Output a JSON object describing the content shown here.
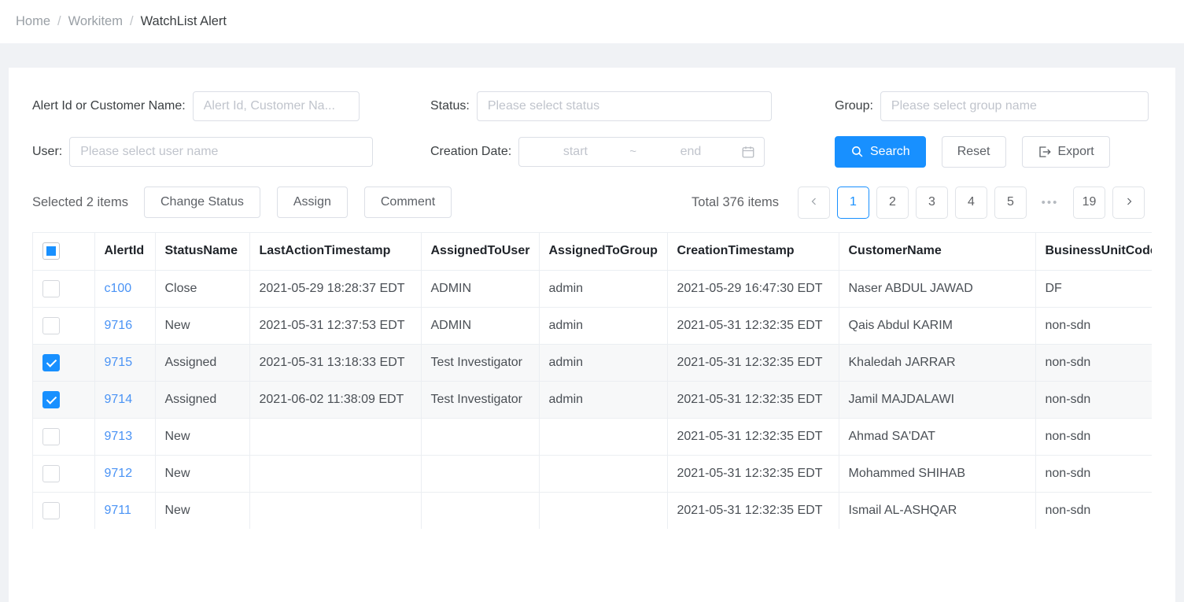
{
  "breadcrumb": {
    "items": [
      {
        "label": "Home",
        "current": false
      },
      {
        "label": "Workitem",
        "current": false
      },
      {
        "label": "WatchList Alert",
        "current": true
      }
    ],
    "separator": "/"
  },
  "filters": {
    "alert_id": {
      "label": "Alert Id or Customer Name:",
      "placeholder": "Alert Id, Customer Na...",
      "value": ""
    },
    "status": {
      "label": "Status:",
      "placeholder": "Please select status",
      "value": ""
    },
    "group": {
      "label": "Group:",
      "placeholder": "Please select group name",
      "value": ""
    },
    "user": {
      "label": "User:",
      "placeholder": "Please select user name",
      "value": ""
    },
    "creation_date": {
      "label": "Creation Date:",
      "start_placeholder": "start",
      "end_placeholder": "end",
      "separator": "~",
      "icon": "calendar-icon"
    }
  },
  "actions": {
    "search": {
      "label": "Search",
      "icon": "search-icon"
    },
    "reset": {
      "label": "Reset"
    },
    "export": {
      "label": "Export",
      "icon": "export-icon"
    }
  },
  "toolbar": {
    "selected_text": "Selected 2 items",
    "change_status": "Change Status",
    "assign": "Assign",
    "comment": "Comment"
  },
  "pagination": {
    "total_text": "Total 376 items",
    "prev_icon": "chevron-left-icon",
    "next_icon": "chevron-right-icon",
    "pages": [
      "1",
      "2",
      "3",
      "4",
      "5"
    ],
    "ellipsis": "•••",
    "last_page": "19",
    "current_page": "1"
  },
  "table": {
    "header_checkbox_state": "indeterminate",
    "columns": [
      "AlertId",
      "StatusName",
      "LastActionTimestamp",
      "AssignedToUser",
      "AssignedToGroup",
      "CreationTimestamp",
      "CustomerName",
      "BusinessUnitCode"
    ],
    "rows": [
      {
        "selected": false,
        "AlertId": "c100",
        "StatusName": "Close",
        "LastActionTimestamp": "2021-05-29 18:28:37 EDT",
        "AssignedToUser": "ADMIN",
        "AssignedToGroup": "admin",
        "CreationTimestamp": "2021-05-29 16:47:30 EDT",
        "CustomerName": "Naser ABDUL JAWAD",
        "BusinessUnitCode": "DF"
      },
      {
        "selected": false,
        "AlertId": "9716",
        "StatusName": "New",
        "LastActionTimestamp": "2021-05-31 12:37:53 EDT",
        "AssignedToUser": "ADMIN",
        "AssignedToGroup": "admin",
        "CreationTimestamp": "2021-05-31 12:32:35 EDT",
        "CustomerName": "Qais Abdul KARIM",
        "BusinessUnitCode": "non-sdn"
      },
      {
        "selected": true,
        "AlertId": "9715",
        "StatusName": "Assigned",
        "LastActionTimestamp": "2021-05-31 13:18:33 EDT",
        "AssignedToUser": "Test Investigator",
        "AssignedToGroup": "admin",
        "CreationTimestamp": "2021-05-31 12:32:35 EDT",
        "CustomerName": "Khaledah JARRAR",
        "BusinessUnitCode": "non-sdn"
      },
      {
        "selected": true,
        "AlertId": "9714",
        "StatusName": "Assigned",
        "LastActionTimestamp": "2021-06-02 11:38:09 EDT",
        "AssignedToUser": "Test Investigator",
        "AssignedToGroup": "admin",
        "CreationTimestamp": "2021-05-31 12:32:35 EDT",
        "CustomerName": "Jamil MAJDALAWI",
        "BusinessUnitCode": "non-sdn"
      },
      {
        "selected": false,
        "AlertId": "9713",
        "StatusName": "New",
        "LastActionTimestamp": "",
        "AssignedToUser": "",
        "AssignedToGroup": "",
        "CreationTimestamp": "2021-05-31 12:32:35 EDT",
        "CustomerName": "Ahmad SA'DAT",
        "BusinessUnitCode": "non-sdn"
      },
      {
        "selected": false,
        "AlertId": "9712",
        "StatusName": "New",
        "LastActionTimestamp": "",
        "AssignedToUser": "",
        "AssignedToGroup": "",
        "CreationTimestamp": "2021-05-31 12:32:35 EDT",
        "CustomerName": "Mohammed SHIHAB",
        "BusinessUnitCode": "non-sdn"
      },
      {
        "selected": false,
        "AlertId": "9711",
        "StatusName": "New",
        "LastActionTimestamp": "",
        "AssignedToUser": "",
        "AssignedToGroup": "",
        "CreationTimestamp": "2021-05-31 12:32:35 EDT",
        "CustomerName": "Ismail AL-ASHQAR",
        "BusinessUnitCode": "non-sdn"
      },
      {
        "selected": false,
        "AlertId": "",
        "StatusName": "",
        "LastActionTimestamp": "",
        "AssignedToUser": "",
        "AssignedToGroup": "",
        "CreationTimestamp": "",
        "CustomerName": "",
        "BusinessUnitCode": ""
      }
    ]
  },
  "colors": {
    "accent": "#1890ff",
    "link": "#4a93f5",
    "page_bg": "#f0f2f5",
    "card_bg": "#ffffff",
    "border": "#ebeef2",
    "selected_row_bg": "#f7f8f9"
  }
}
